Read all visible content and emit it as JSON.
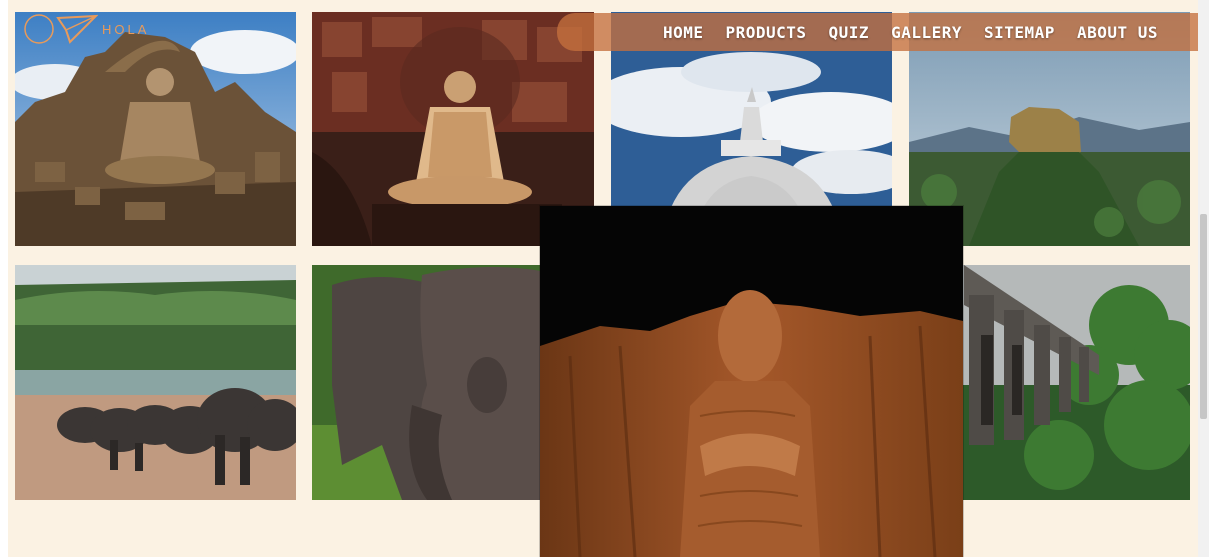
{
  "logo": {
    "text": "HOLA",
    "icon": "paper-plane-icon"
  },
  "nav": {
    "items": [
      {
        "label": "HOME"
      },
      {
        "label": "PRODUCTS"
      },
      {
        "label": "QUIZ"
      },
      {
        "label": "GALLERY"
      },
      {
        "label": "SITEMAP"
      },
      {
        "label": "ABOUT US"
      }
    ]
  },
  "gallery": {
    "tiles": [
      {
        "subject": "seated buddha statue ruins"
      },
      {
        "subject": "cave temple buddha"
      },
      {
        "subject": "white stupa against clouds"
      },
      {
        "subject": "rock fortress"
      },
      {
        "subject": "elephant herd at river"
      },
      {
        "subject": "elephants grazing"
      },
      {
        "subject": "stone arch bridge in forest"
      }
    ],
    "featured": {
      "subject": "standing rock buddha"
    }
  },
  "colors": {
    "background": "#fbf2e3",
    "nav_bar": "#c4703e",
    "nav_text": "#ffffff",
    "logo": "#e89a5a"
  }
}
